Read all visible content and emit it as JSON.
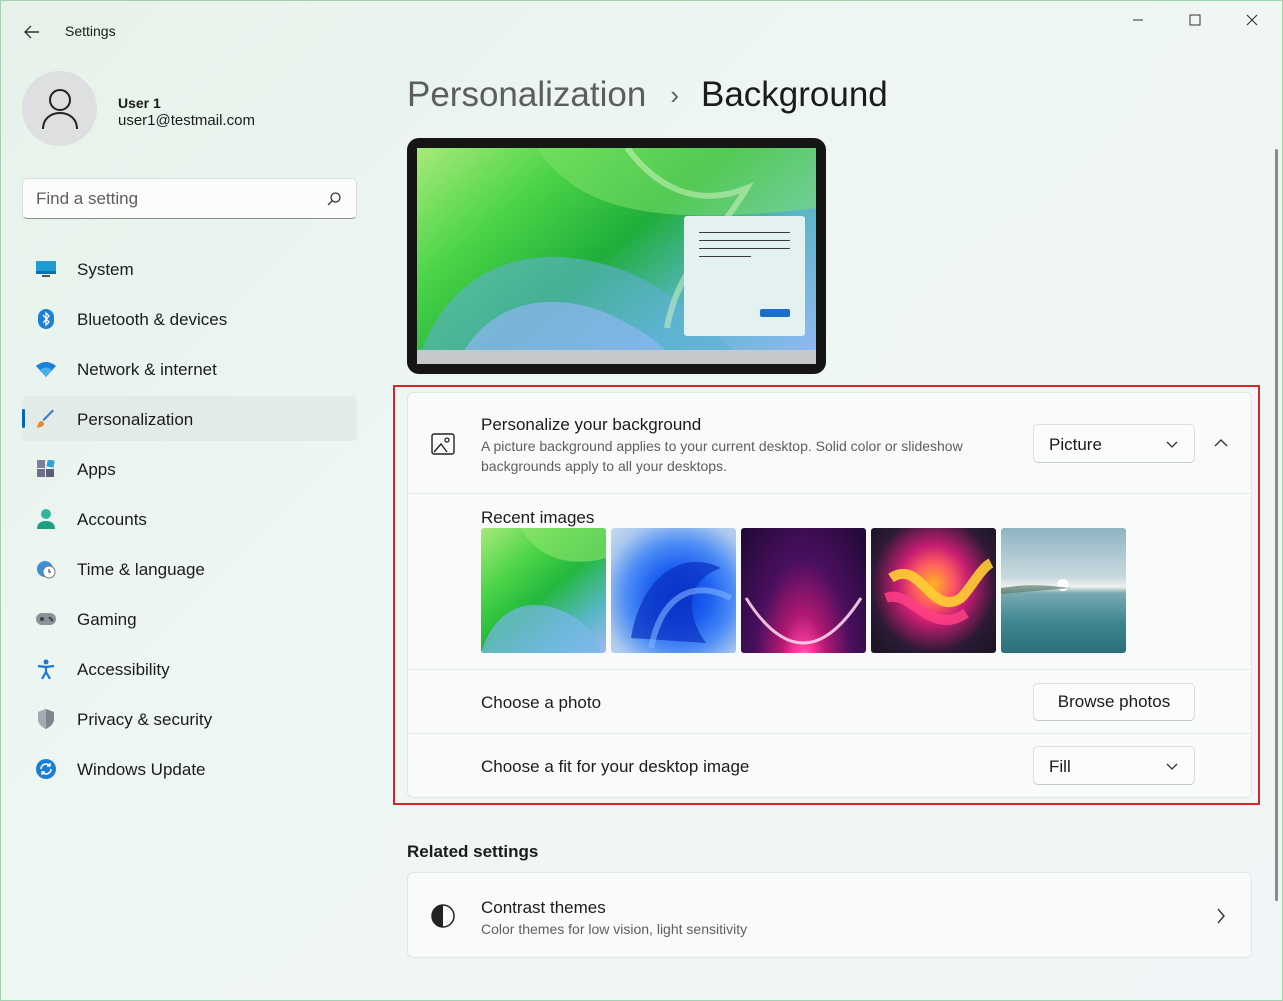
{
  "window": {
    "title": "Settings"
  },
  "user": {
    "name": "User 1",
    "email": "user1@testmail.com"
  },
  "search": {
    "placeholder": "Find a setting",
    "value": ""
  },
  "nav": [
    {
      "label": "System",
      "icon": "monitor-icon"
    },
    {
      "label": "Bluetooth & devices",
      "icon": "bluetooth-icon"
    },
    {
      "label": "Network & internet",
      "icon": "wifi-icon"
    },
    {
      "label": "Personalization",
      "icon": "brush-icon",
      "active": true
    },
    {
      "label": "Apps",
      "icon": "apps-icon"
    },
    {
      "label": "Accounts",
      "icon": "person-icon"
    },
    {
      "label": "Time & language",
      "icon": "globe-clock-icon"
    },
    {
      "label": "Gaming",
      "icon": "gamepad-icon"
    },
    {
      "label": "Accessibility",
      "icon": "accessibility-icon"
    },
    {
      "label": "Privacy & security",
      "icon": "shield-icon"
    },
    {
      "label": "Windows Update",
      "icon": "update-icon"
    }
  ],
  "breadcrumb": {
    "parent": "Personalization",
    "separator": "›",
    "current": "Background"
  },
  "personalize": {
    "title": "Personalize your background",
    "description": "A picture background applies to your current desktop. Solid color or slideshow backgrounds apply to all your desktops.",
    "selected": "Picture",
    "recent_label": "Recent images",
    "recent_images": [
      "green-swirl",
      "blue-bloom",
      "purple-glow",
      "colorful-ribbon",
      "lake-sunrise"
    ]
  },
  "choose_photo": {
    "label": "Choose a photo",
    "button": "Browse photos"
  },
  "fit": {
    "label": "Choose a fit for your desktop image",
    "selected": "Fill"
  },
  "related": {
    "heading": "Related settings",
    "items": [
      {
        "title": "Contrast themes",
        "description": "Color themes for low vision, light sensitivity"
      }
    ]
  },
  "colors": {
    "accent": "#0067c0",
    "highlight": "#d8232a"
  }
}
